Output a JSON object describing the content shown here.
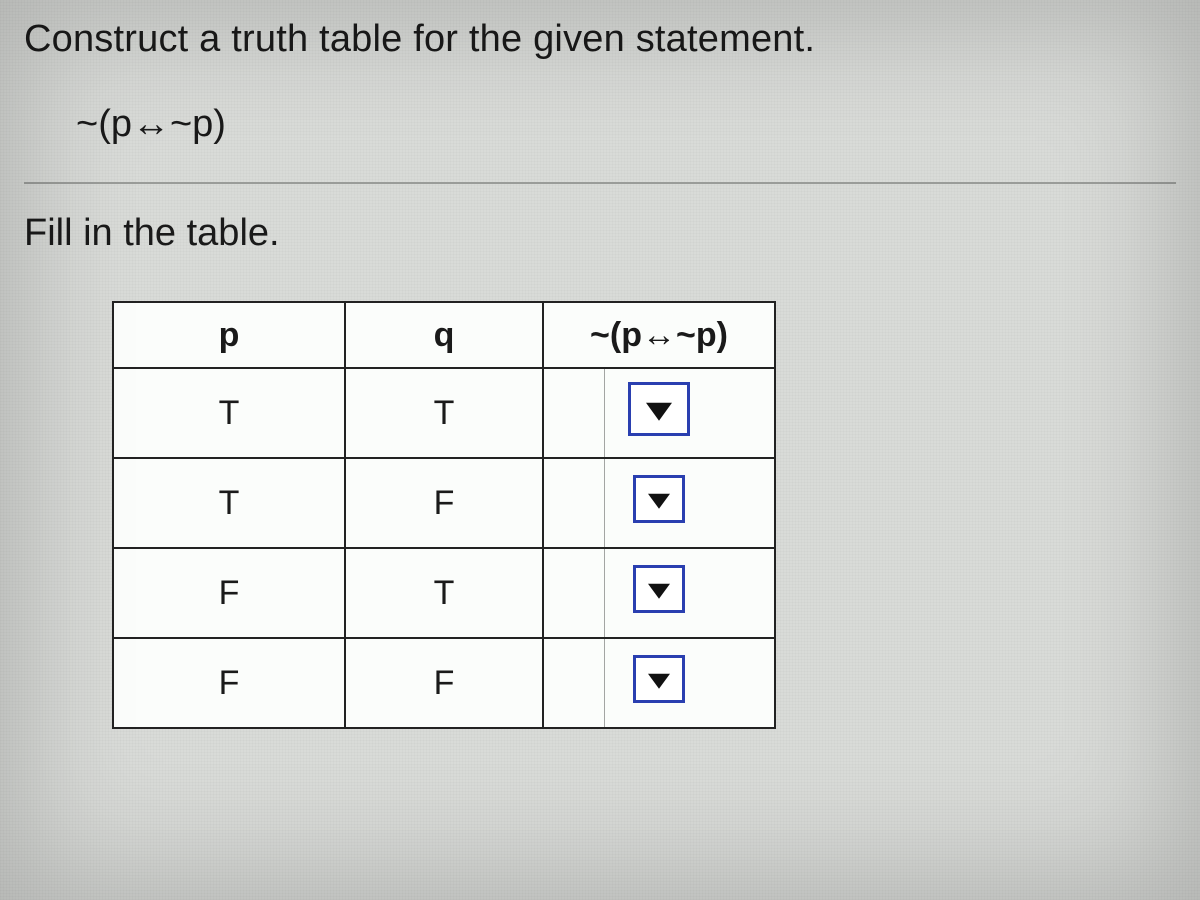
{
  "prompt": "Construct a truth table for the given statement.",
  "statement": "~(p↔~p)",
  "instruction": "Fill in the table.",
  "table": {
    "headers": {
      "p": "p",
      "q": "q",
      "result": "~(p↔~p)"
    },
    "rows": [
      {
        "p": "T",
        "q": "T"
      },
      {
        "p": "T",
        "q": "F"
      },
      {
        "p": "F",
        "q": "T"
      },
      {
        "p": "F",
        "q": "F"
      }
    ]
  }
}
